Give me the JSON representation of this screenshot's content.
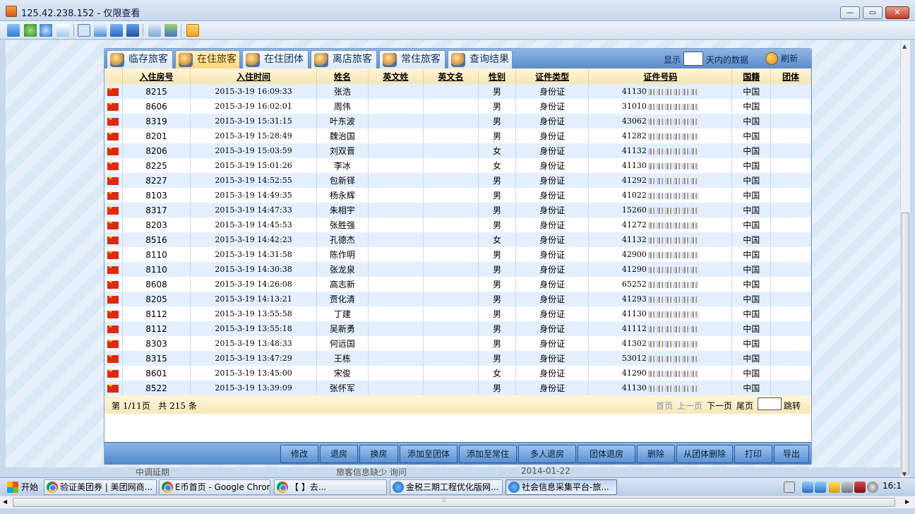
{
  "window": {
    "title": "125.42.238.152 - 仅限查看",
    "min": "—",
    "max": "▭",
    "close": "✕"
  },
  "tabs": [
    "临存旅客",
    "在住旅客",
    "在住团体",
    "离店旅客",
    "常住旅客",
    "查询结果"
  ],
  "active_tab": "在住旅客",
  "filter": {
    "show_label": "显示",
    "days_value": "",
    "days_suffix": "天内的数据",
    "refresh": "刷新"
  },
  "columns": [
    "",
    "入住房号",
    "入住时间",
    "姓名",
    "英文姓",
    "英文名",
    "性别",
    "证件类型",
    "证件号码",
    "国籍",
    "团体"
  ],
  "rows": [
    {
      "room": "8215",
      "time": "2015-3-19 16:09:33",
      "name": "张浩",
      "gender": "男",
      "id_type": "身份证",
      "id_prefix": "41130",
      "nation": "中国"
    },
    {
      "room": "8606",
      "time": "2015-3-19 16:02:01",
      "name": "周伟",
      "gender": "男",
      "id_type": "身份证",
      "id_prefix": "31010",
      "nation": "中国"
    },
    {
      "room": "8319",
      "time": "2015-3-19 15:31:15",
      "name": "叶东波",
      "gender": "男",
      "id_type": "身份证",
      "id_prefix": "43062",
      "nation": "中国"
    },
    {
      "room": "8201",
      "time": "2015-3-19 15:28:49",
      "name": "魏治国",
      "gender": "男",
      "id_type": "身份证",
      "id_prefix": "41282",
      "nation": "中国"
    },
    {
      "room": "8206",
      "time": "2015-3-19 15:03:59",
      "name": "刘双晋",
      "gender": "女",
      "id_type": "身份证",
      "id_prefix": "41132",
      "nation": "中国"
    },
    {
      "room": "8225",
      "time": "2015-3-19 15:01:26",
      "name": "李冰",
      "gender": "女",
      "id_type": "身份证",
      "id_prefix": "41130",
      "nation": "中国"
    },
    {
      "room": "8227",
      "time": "2015-3-19 14:52:55",
      "name": "包新铎",
      "gender": "男",
      "id_type": "身份证",
      "id_prefix": "41292",
      "nation": "中国"
    },
    {
      "room": "8103",
      "time": "2015-3-19 14:49:35",
      "name": "杨永辉",
      "gender": "男",
      "id_type": "身份证",
      "id_prefix": "41022",
      "nation": "中国"
    },
    {
      "room": "8317",
      "time": "2015-3-19 14:47:33",
      "name": "朱相宇",
      "gender": "男",
      "id_type": "身份证",
      "id_prefix": "15260",
      "nation": "中国"
    },
    {
      "room": "8203",
      "time": "2015-3-19 14:45:53",
      "name": "张胜强",
      "gender": "男",
      "id_type": "身份证",
      "id_prefix": "41272",
      "nation": "中国"
    },
    {
      "room": "8516",
      "time": "2015-3-19 14:42:23",
      "name": "孔德杰",
      "gender": "女",
      "id_type": "身份证",
      "id_prefix": "41132",
      "nation": "中国"
    },
    {
      "room": "8110",
      "time": "2015-3-19 14:31:58",
      "name": "陈作明",
      "gender": "男",
      "id_type": "身份证",
      "id_prefix": "42900",
      "nation": "中国"
    },
    {
      "room": "8110",
      "time": "2015-3-19 14:30:38",
      "name": "张龙泉",
      "gender": "男",
      "id_type": "身份证",
      "id_prefix": "41290",
      "nation": "中国"
    },
    {
      "room": "8608",
      "time": "2015-3-19 14:26:08",
      "name": "高志新",
      "gender": "男",
      "id_type": "身份证",
      "id_prefix": "65252",
      "nation": "中国"
    },
    {
      "room": "8205",
      "time": "2015-3-19 14:13:21",
      "name": "贾化清",
      "gender": "男",
      "id_type": "身份证",
      "id_prefix": "41293",
      "nation": "中国"
    },
    {
      "room": "8112",
      "time": "2015-3-19 13:55:58",
      "name": "丁建",
      "gender": "男",
      "id_type": "身份证",
      "id_prefix": "41130",
      "nation": "中国"
    },
    {
      "room": "8112",
      "time": "2015-3-19 13:55:18",
      "name": "吴新勇",
      "gender": "男",
      "id_type": "身份证",
      "id_prefix": "41112",
      "nation": "中国"
    },
    {
      "room": "8303",
      "time": "2015-3-19 13:48:33",
      "name": "何远国",
      "gender": "男",
      "id_type": "身份证",
      "id_prefix": "41302",
      "nation": "中国"
    },
    {
      "room": "8315",
      "time": "2015-3-19 13:47:29",
      "name": "王栋",
      "gender": "男",
      "id_type": "身份证",
      "id_prefix": "53012",
      "nation": "中国"
    },
    {
      "room": "8601",
      "time": "2015-3-19 13:45:00",
      "name": "宋俊",
      "gender": "女",
      "id_type": "身份证",
      "id_prefix": "41290",
      "nation": "中国"
    },
    {
      "room": "8522",
      "time": "2015-3-19 13:39:09",
      "name": "张怀军",
      "gender": "男",
      "id_type": "身份证",
      "id_prefix": "41130",
      "nation": "中国"
    }
  ],
  "pager": {
    "page_prefix": "第",
    "page": "1/11",
    "page_unit": "页",
    "total_prefix": "共",
    "total": "215",
    "total_unit": "条",
    "first": "首页",
    "prev": "上一页",
    "next": "下一页",
    "last": "尾页",
    "jump": "跳转"
  },
  "actions": [
    "修改",
    "退房",
    "换房",
    "添加至团体",
    "添加至常住",
    "多人退房",
    "团体退房",
    "删除",
    "从团体删除",
    "打印",
    "导出"
  ],
  "peek": [
    "中调延期",
    "旅客信息缺少  询问",
    "2014-01-22"
  ],
  "taskbar": {
    "start": "开始",
    "tasks": [
      "验证美团券 | 美团网商...",
      "E币首页 - Google Chrome",
      "【                】去...",
      "金税三期工程优化版网...",
      "社会信息采集平台-旅..."
    ],
    "clock": "16:1"
  },
  "colors": {
    "tab_bar": "#5a8ccc",
    "active_tab": "#fbd97a",
    "row_alt": "#e3efff",
    "header": "#f6e4b3"
  }
}
